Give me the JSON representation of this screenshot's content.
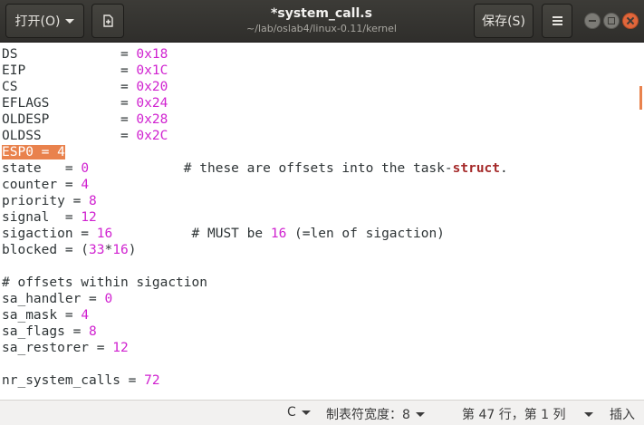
{
  "header": {
    "open_label": "打开(O)",
    "save_label": "保存(S)",
    "title": "*system_call.s",
    "subtitle": "~/lab/oslab4/linux-0.11/kernel"
  },
  "editor": {
    "lines": [
      [
        {
          "t": "DS             = "
        },
        {
          "t": "0x18",
          "c": "num"
        }
      ],
      [
        {
          "t": "EIP            = "
        },
        {
          "t": "0x1C",
          "c": "num"
        }
      ],
      [
        {
          "t": "CS             = "
        },
        {
          "t": "0x20",
          "c": "num"
        }
      ],
      [
        {
          "t": "EFLAGS         = "
        },
        {
          "t": "0x24",
          "c": "num"
        }
      ],
      [
        {
          "t": "OLDESP         = "
        },
        {
          "t": "0x28",
          "c": "num"
        }
      ],
      [
        {
          "t": "OLDSS          = "
        },
        {
          "t": "0x2C",
          "c": "num"
        }
      ],
      [
        {
          "t": "ESP0 = 4",
          "c": "hl"
        }
      ],
      [
        {
          "t": "state   = "
        },
        {
          "t": "0",
          "c": "num"
        },
        {
          "t": "            # these are offsets into the task-"
        },
        {
          "t": "struct",
          "c": "kw"
        },
        {
          "t": "."
        }
      ],
      [
        {
          "t": "counter = "
        },
        {
          "t": "4",
          "c": "num"
        }
      ],
      [
        {
          "t": "priority = "
        },
        {
          "t": "8",
          "c": "num"
        }
      ],
      [
        {
          "t": "signal  = "
        },
        {
          "t": "12",
          "c": "num"
        }
      ],
      [
        {
          "t": "sigaction = "
        },
        {
          "t": "16",
          "c": "num"
        },
        {
          "t": "          # MUST be "
        },
        {
          "t": "16",
          "c": "num"
        },
        {
          "t": " (=len of sigaction)"
        }
      ],
      [
        {
          "t": "blocked = ("
        },
        {
          "t": "33",
          "c": "num"
        },
        {
          "t": "*"
        },
        {
          "t": "16",
          "c": "num"
        },
        {
          "t": ")"
        }
      ],
      [],
      [
        {
          "t": "# offsets within sigaction"
        }
      ],
      [
        {
          "t": "sa_handler = "
        },
        {
          "t": "0",
          "c": "num"
        }
      ],
      [
        {
          "t": "sa_mask = "
        },
        {
          "t": "4",
          "c": "num"
        }
      ],
      [
        {
          "t": "sa_flags = "
        },
        {
          "t": "8",
          "c": "num"
        }
      ],
      [
        {
          "t": "sa_restorer = "
        },
        {
          "t": "12",
          "c": "num"
        }
      ],
      [],
      [
        {
          "t": "nr_system_calls = "
        },
        {
          "t": "72",
          "c": "num"
        }
      ]
    ]
  },
  "status": {
    "language": "C",
    "tab_width": "制表符宽度：8",
    "position": "第 47 行，第 1 列",
    "insert_mode": "插入"
  },
  "colors": {
    "number": "#d022d0",
    "keyword": "#a52a2a",
    "highlight": "#e9824d",
    "titlebar": "#3c3b37"
  },
  "icons": {
    "new_document": "new-document-icon",
    "menu": "hamburger-menu-icon",
    "minimize": "minimize-icon",
    "maximize": "maximize-icon",
    "close": "close-icon"
  }
}
